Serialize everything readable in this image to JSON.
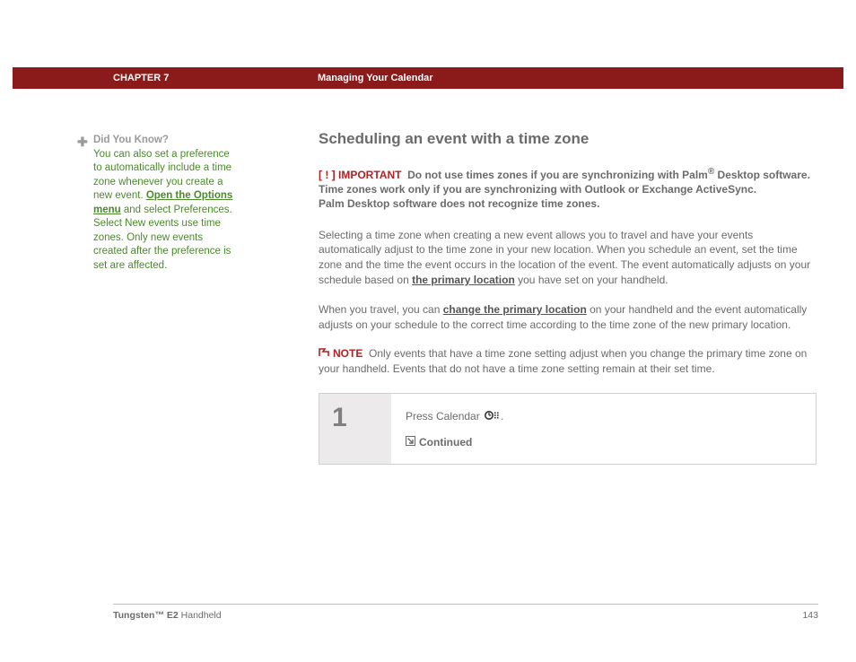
{
  "header": {
    "chapter": "CHAPTER 7",
    "title": "Managing Your Calendar"
  },
  "sidebar": {
    "heading": "Did You Know?",
    "text_before": "You can also set a preference to automatically include a time zone whenever you create a new event. ",
    "link": "Open the Options menu",
    "text_after": " and select Preferences. Select New events use time zones. Only new events created after the preference is set are affected."
  },
  "main": {
    "h1": "Scheduling an event with a time zone",
    "important": {
      "bracket": "[ ! ]",
      "label": "IMPORTANT",
      "line1a": "Do not use times zones if you are synchronizing with Palm",
      "reg": "®",
      "line1b": " Desktop software. Time zones work only if you are synchronizing with Outlook or Exchange ActiveSync.",
      "line2": "Palm Desktop software does not recognize time zones."
    },
    "para1a": "Selecting a time zone when creating a new event allows you to travel and have your events automatically adjust to the time zone in your new location. When you schedule an event, set the time zone and the time the event occurs in the location of the event. The event automatically adjusts on your schedule based on ",
    "para1_link": "the primary location",
    "para1b": " you have set on your handheld.",
    "para2a": "When you travel, you can ",
    "para2_link": "change the primary location",
    "para2b": " on your handheld and the event automatically adjusts on your schedule to the correct time according to the time zone of the new primary location.",
    "note": {
      "label": "NOTE",
      "text": "Only events that have a time zone setting adjust when you change the primary time zone on your handheld. Events that do not have a time zone setting remain at their set time."
    },
    "step": {
      "num": "1",
      "text": "Press Calendar ",
      "period": ".",
      "continued": "Continued"
    }
  },
  "footer": {
    "product_bold": "Tungsten™ E2",
    "product_rest": " Handheld",
    "page": "143"
  }
}
